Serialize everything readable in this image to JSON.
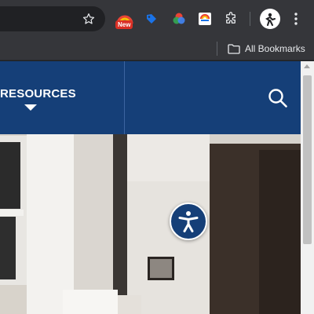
{
  "browser": {
    "extensions": {
      "new_badge": "New"
    },
    "bookmarks_bar": {
      "all_bookmarks_label": "All Bookmarks"
    }
  },
  "site": {
    "nav": {
      "resources_label": "RESOURCES"
    },
    "colors": {
      "nav_background": "#153f78",
      "accessibility_button": "#153f78"
    }
  },
  "icons": {
    "bookmark_star": "star-icon",
    "search": "search-icon",
    "accessibility": "accessibility-icon",
    "extensions": "puzzle-icon",
    "menu": "kebab-menu-icon",
    "folder": "folder-icon"
  }
}
